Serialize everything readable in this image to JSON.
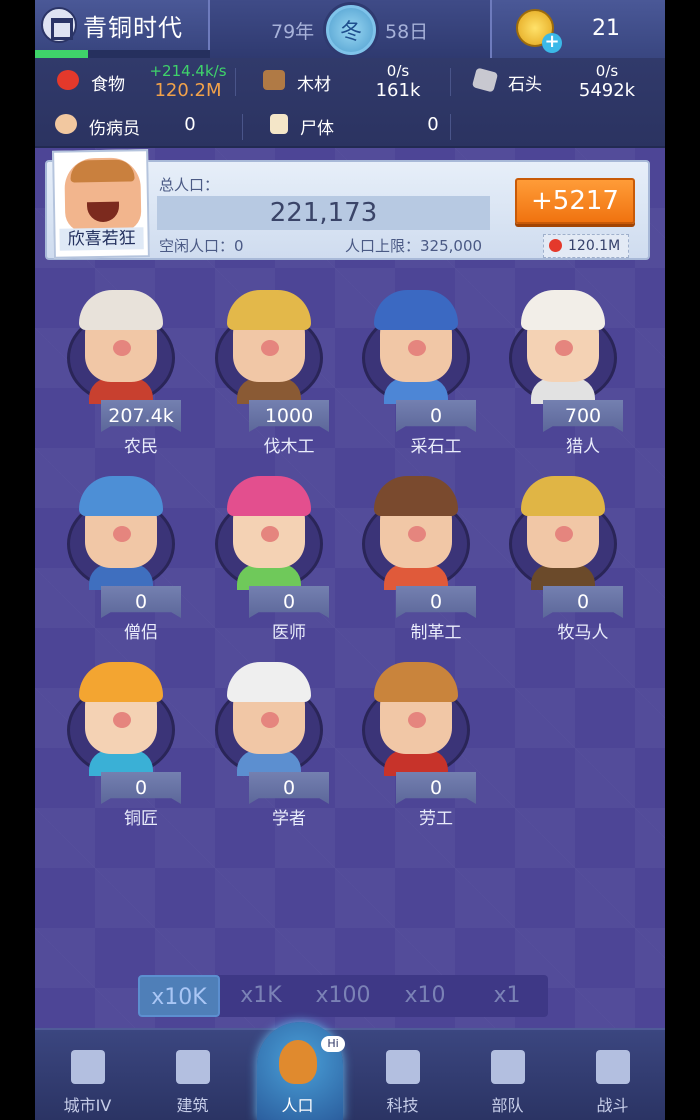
{
  "header": {
    "era_title": "青铜时代",
    "year": "79年",
    "season": "冬",
    "day": "58日",
    "gold": "21",
    "era_progress_pct": 30
  },
  "resources": {
    "food": {
      "label": "食物",
      "rate": "+214.4k/s",
      "value": "120.2M"
    },
    "wood": {
      "label": "木材",
      "rate": "0/s",
      "value": "161k"
    },
    "stone": {
      "label": "石头",
      "rate": "0/s",
      "value": "5492k"
    },
    "wounded": {
      "label": "伤病员",
      "value": "0"
    },
    "corpse": {
      "label": "尸体",
      "value": "0"
    }
  },
  "population": {
    "leader_mood": "欣喜若狂",
    "title": "总人口：",
    "total": "221,173",
    "idle": "空闲人口：0",
    "cap": "人口上限：325,000",
    "add_button": "+5217",
    "cost": "120.1M"
  },
  "jobs": [
    {
      "name": "农民",
      "count": "207.4k"
    },
    {
      "name": "伐木工",
      "count": "1000"
    },
    {
      "name": "采石工",
      "count": "0"
    },
    {
      "name": "猎人",
      "count": "700"
    },
    {
      "name": "僧侣",
      "count": "0"
    },
    {
      "name": "医师",
      "count": "0"
    },
    {
      "name": "制革工",
      "count": "0"
    },
    {
      "name": "牧马人",
      "count": "0"
    },
    {
      "name": "铜匠",
      "count": "0"
    },
    {
      "name": "学者",
      "count": "0"
    },
    {
      "name": "劳工",
      "count": "0"
    }
  ],
  "multipliers": [
    "x10K",
    "x1K",
    "x100",
    "x10",
    "x1"
  ],
  "nav": [
    "城市IV",
    "建筑",
    "人口",
    "科技",
    "部队",
    "战斗"
  ],
  "nav_badge": "Hi",
  "colors": {
    "accent_orange": "#f07310",
    "rate_green": "#3fd36a",
    "food_value_orange": "#f2a24a",
    "background": "#4a4298"
  }
}
